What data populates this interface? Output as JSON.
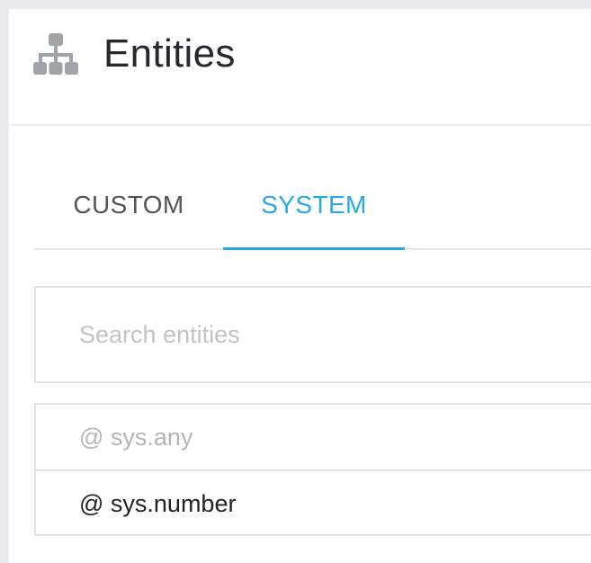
{
  "header": {
    "title": "Entities",
    "icon": "sitemap-icon"
  },
  "tabs": [
    {
      "label": "CUSTOM",
      "active": false
    },
    {
      "label": "SYSTEM",
      "active": true
    }
  ],
  "search": {
    "placeholder": "Search entities",
    "value": ""
  },
  "entities": [
    {
      "label": "@ sys.any",
      "muted": true
    },
    {
      "label": "@ sys.number",
      "muted": false
    }
  ],
  "colors": {
    "accent": "#29a8e6",
    "title": "#26282f",
    "icon": "#a0a3a8",
    "muted_text": "#b5b5b5"
  }
}
